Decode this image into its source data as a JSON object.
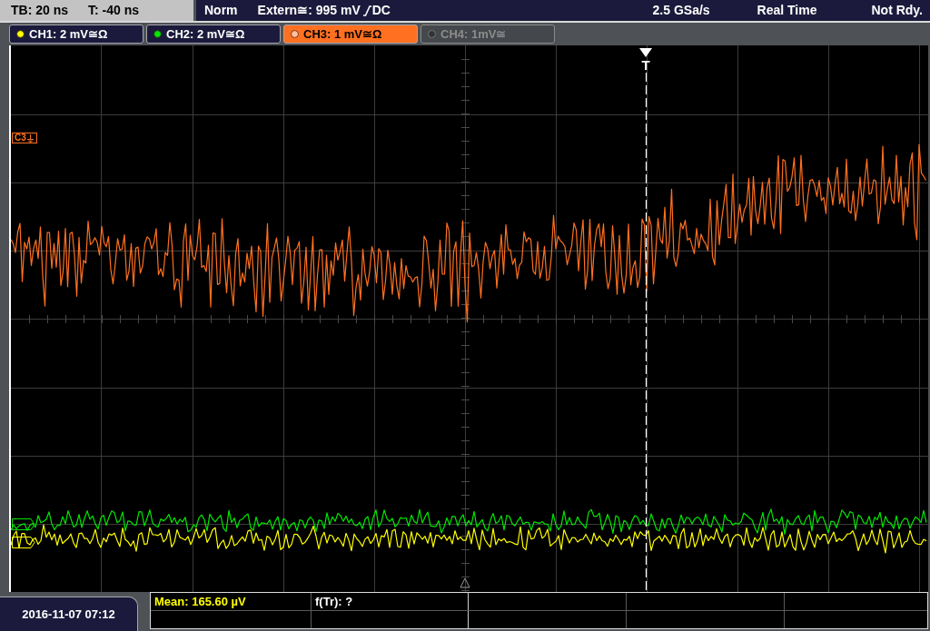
{
  "header": {
    "timebase": "TB: 20 ns",
    "trigger_offset": "T: -40 ns",
    "trigger_mode": "Norm",
    "trigger_source": "Extern≅: 995 mV",
    "trigger_coupling": "DC",
    "sample_rate": "2.5 GSa/s",
    "acquisition_mode": "Real Time",
    "status": "Not Rdy."
  },
  "channels": [
    {
      "label": "CH1: 2 mV≅Ω",
      "color": "#ffff00",
      "selected": false,
      "on": true
    },
    {
      "label": "CH2: 2 mV≅Ω",
      "color": "#00e800",
      "selected": false,
      "on": true
    },
    {
      "label": "CH3: 1 mV≅Ω",
      "color": "#ff7020",
      "selected": true,
      "on": true,
      "marker": "C3"
    },
    {
      "label": "CH4: 1mV≅",
      "selected": false,
      "on": false
    }
  ],
  "trigger_marker": "T",
  "measurements": [
    {
      "label": "Mean: 165.60 µV",
      "color": "#ffff00"
    },
    {
      "label": "f(Tr): ?",
      "color": "#ffffff"
    }
  ],
  "timestamp": "2016-11-07 07:12"
}
